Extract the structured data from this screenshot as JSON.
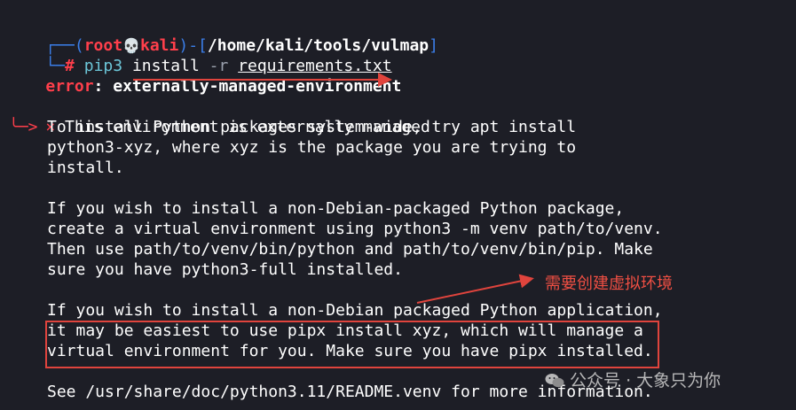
{
  "prompt": {
    "corner_top": "┌──(",
    "user": "root",
    "skull": "💀",
    "host": "kali",
    "sep": ")-[",
    "cwd": "/home/kali/tools/vulmap",
    "close": "]",
    "corner_bottom": "└─",
    "hash": "#"
  },
  "command": {
    "program": "pip3",
    "sub": "install",
    "flag": "-r",
    "file": "requirements.txt"
  },
  "error": {
    "label": "error",
    "colon": ":",
    "message": "externally-managed-environment"
  },
  "notice": {
    "x_mark": "×",
    "headline": "This environment is externally managed",
    "arrow": "╰─>",
    "lines": [
      "To install Python packages system-wide, try apt install",
      "python3-xyz, where xyz is the package you are trying to",
      "install.",
      "",
      "If you wish to install a non-Debian-packaged Python package,",
      "create a virtual environment using python3 -m venv path/to/venv.",
      "Then use path/to/venv/bin/python and path/to/venv/bin/pip. Make",
      "sure you have python3-full installed.",
      "",
      "If you wish to install a non-Debian packaged Python application,",
      "it may be easiest to use pipx install xyz, which will manage a",
      "virtual environment for you. Make sure you have pipx installed.",
      "",
      "See /usr/share/doc/python3.11/README.venv for more information."
    ]
  },
  "annotation": {
    "note": "需要创建虚拟环境",
    "color": "#e0443d"
  },
  "watermark": {
    "text": "公众号 · 大象只为你",
    "icon": "wechat-icon"
  }
}
